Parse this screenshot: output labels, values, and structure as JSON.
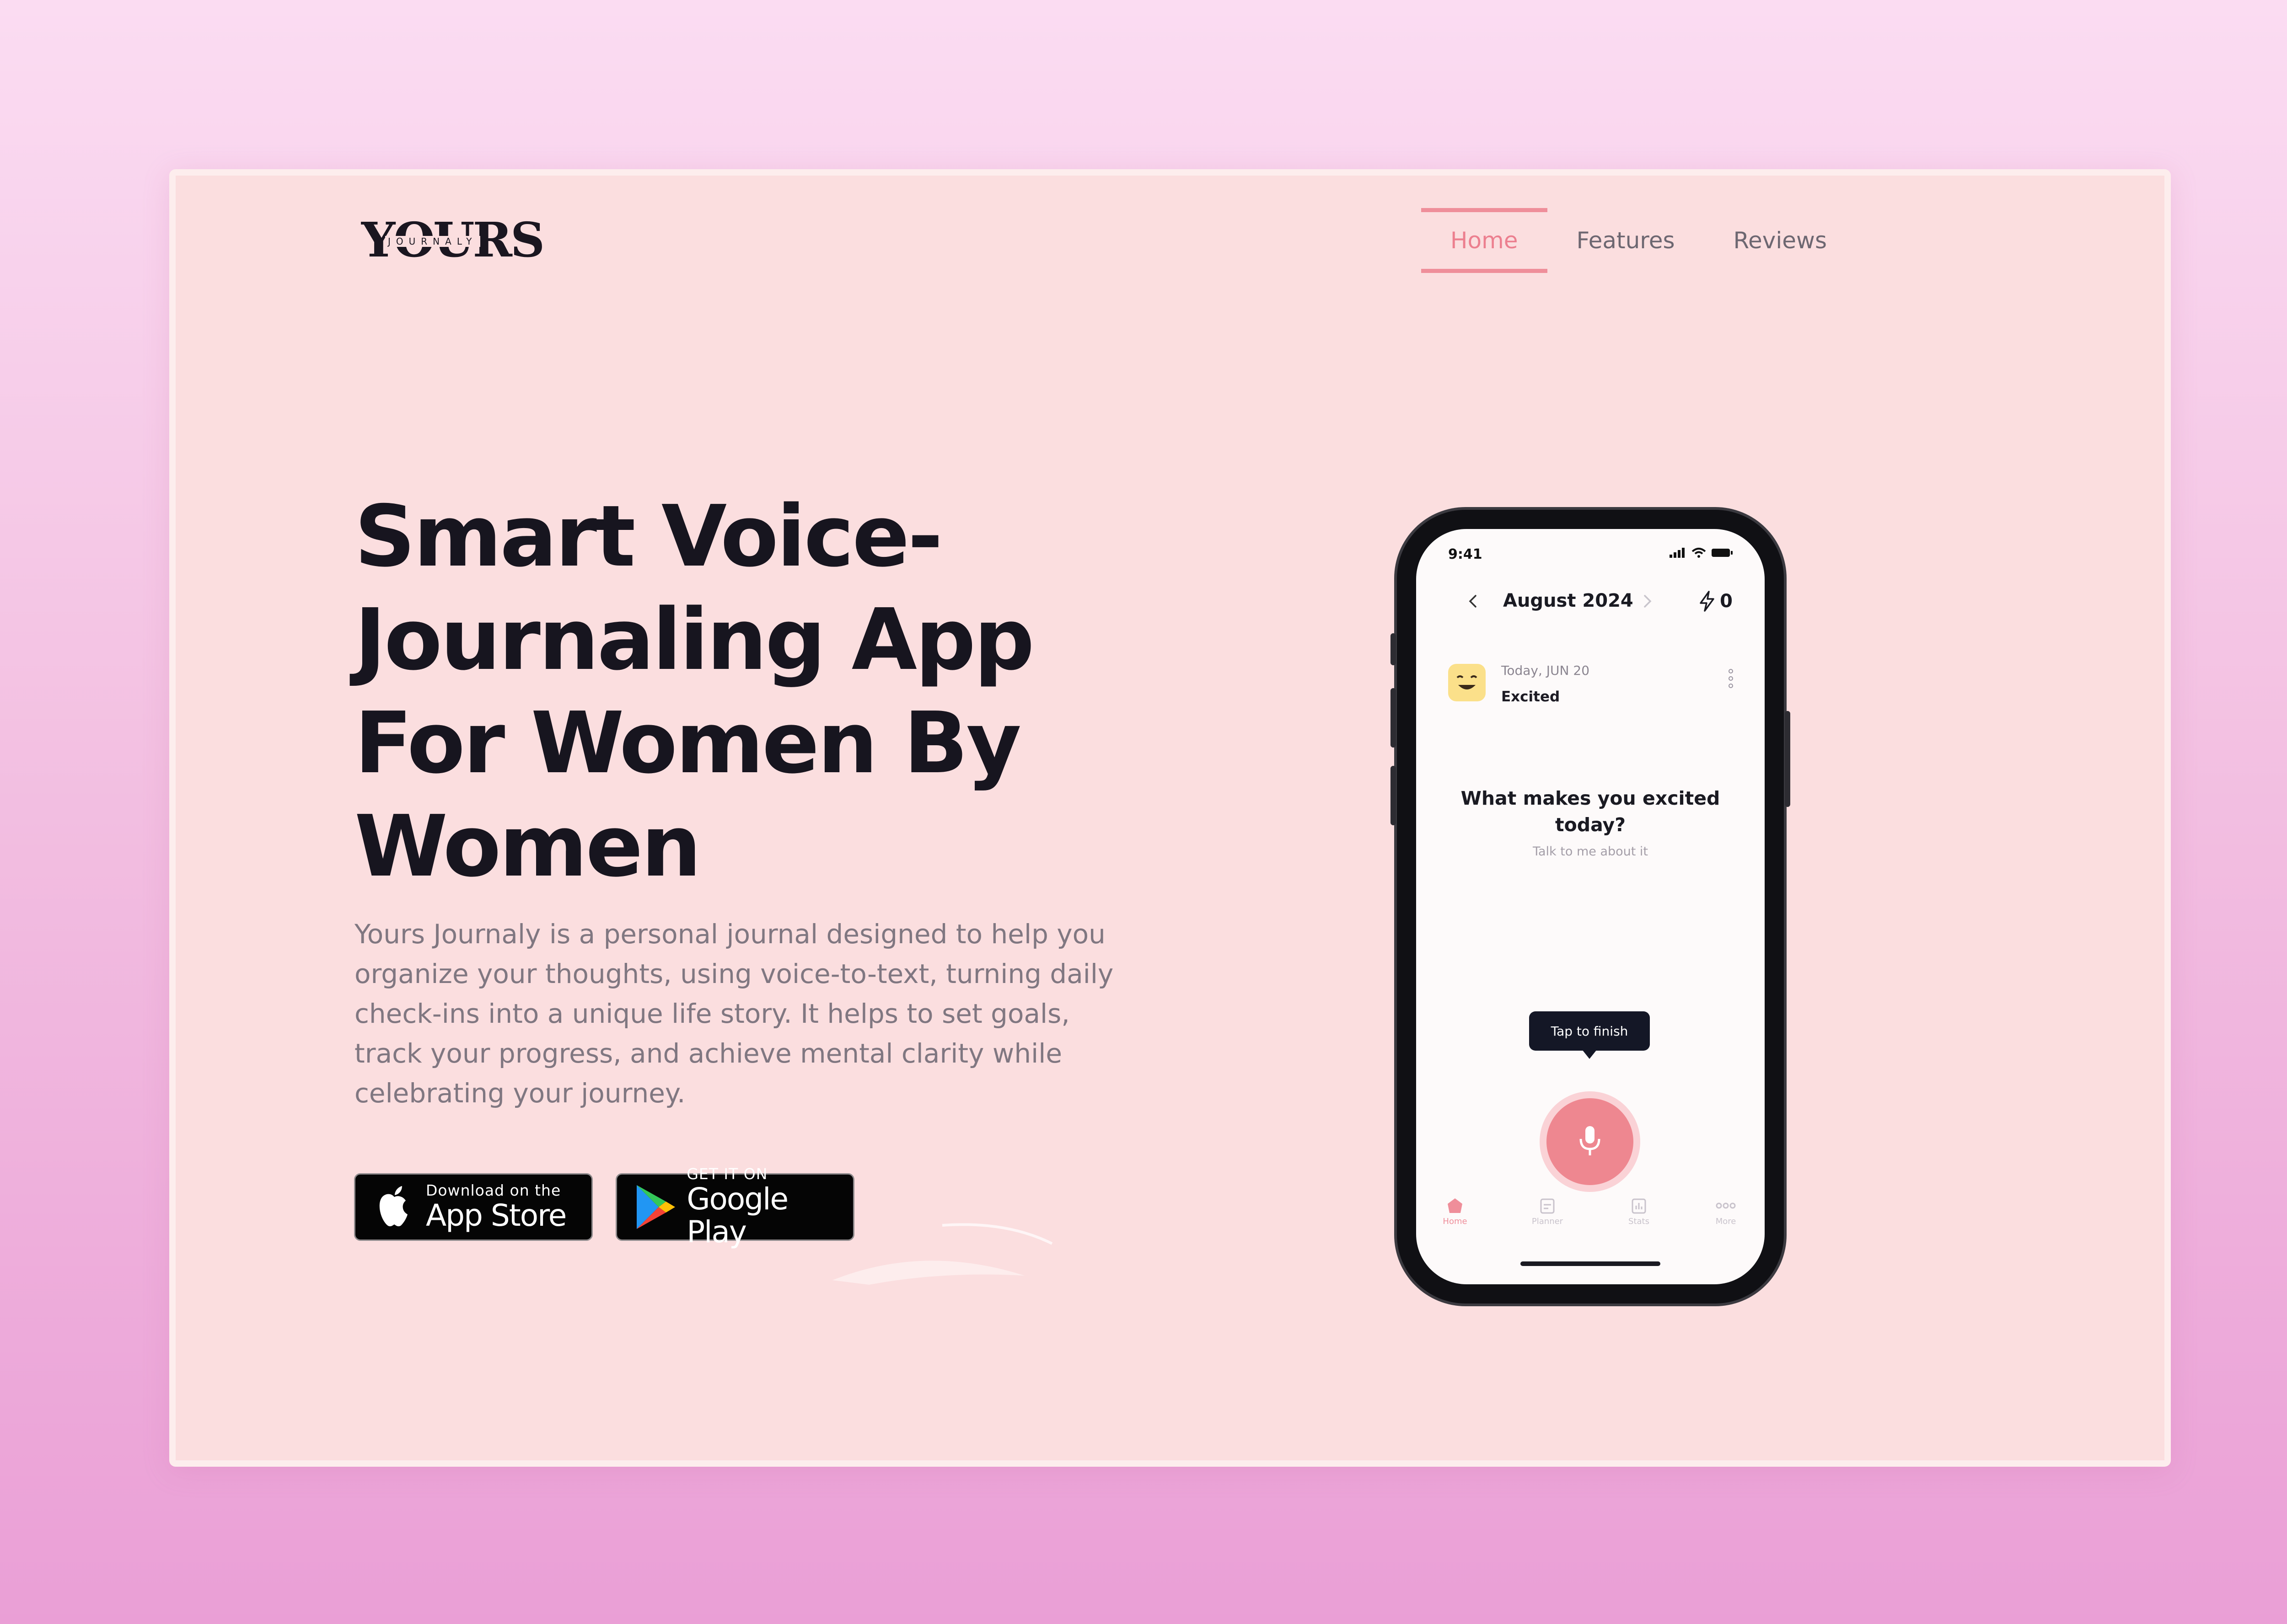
{
  "brand": {
    "logo_main": "YOURS",
    "logo_sub": "JOURNALY"
  },
  "nav": {
    "items": [
      {
        "label": "Home",
        "active": true
      },
      {
        "label": "Features",
        "active": false
      },
      {
        "label": "Reviews",
        "active": false
      }
    ]
  },
  "hero": {
    "title_lines": [
      "Smart Voice-",
      "Journaling App",
      "For Women By",
      "Women"
    ],
    "description": "Yours Journaly is a personal journal designed to help you organize your thoughts, using voice-to-text, turning daily check-ins into a unique life story. It helps to set goals, track your progress, and achieve mental clarity while celebrating your journey."
  },
  "store_buttons": {
    "apple": {
      "small": "Download on the",
      "big": "App Store",
      "icon": "apple-icon"
    },
    "google": {
      "small": "GET IT ON",
      "big": "Google Play",
      "icon": "google-play-icon"
    }
  },
  "phone": {
    "status_time": "9:41",
    "month": "August 2024",
    "streak_count": "0",
    "entry": {
      "date": "Today, JUN 20",
      "mood": "Excited",
      "emoji": "smiling-face-icon"
    },
    "prompt_question": "What makes you excited today?",
    "prompt_sub": "Talk to me about it",
    "tooltip": "Tap to finish",
    "tabs": [
      {
        "label": "Home",
        "icon": "home-icon",
        "active": true
      },
      {
        "label": "Planner",
        "icon": "planner-icon",
        "active": false
      },
      {
        "label": "Stats",
        "icon": "stats-icon",
        "active": false
      },
      {
        "label": "More",
        "icon": "more-icon",
        "active": false
      }
    ]
  },
  "colors": {
    "accent": "#ef8e9a",
    "page_bg": "#fbdedf",
    "text_dark": "#17151f",
    "text_muted": "#807781",
    "mic": "#ee8790"
  }
}
